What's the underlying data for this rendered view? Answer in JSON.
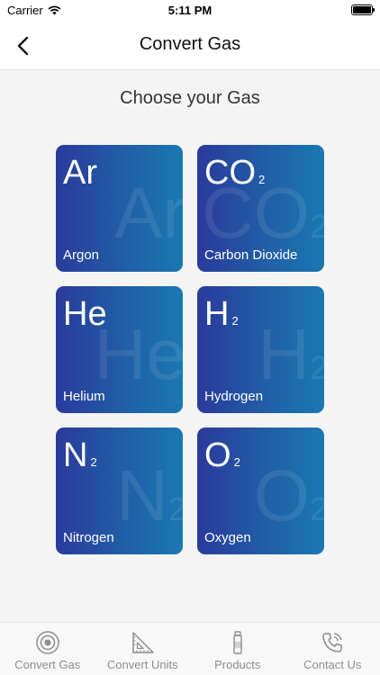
{
  "status_bar": {
    "carrier": "Carrier",
    "time": "5:11 PM"
  },
  "nav": {
    "title": "Convert Gas",
    "back_icon": "chevron-left-icon"
  },
  "subtitle": "Choose your Gas",
  "gases": [
    {
      "symbol": "Ar",
      "subscript": "",
      "name": "Argon"
    },
    {
      "symbol": "CO",
      "subscript": "2",
      "name": "Carbon Dioxide"
    },
    {
      "symbol": "He",
      "subscript": "",
      "name": "Helium"
    },
    {
      "symbol": "H",
      "subscript": "2",
      "name": "Hydrogen"
    },
    {
      "symbol": "N",
      "subscript": "2",
      "name": "Nitrogen"
    },
    {
      "symbol": "O",
      "subscript": "2",
      "name": "Oxygen"
    }
  ],
  "tabs": [
    {
      "label": "Convert Gas",
      "icon": "gas-cylinder-icon",
      "active": true
    },
    {
      "label": "Convert Units",
      "icon": "set-square-icon",
      "active": false
    },
    {
      "label": "Products",
      "icon": "bottle-icon",
      "active": false
    },
    {
      "label": "Contact Us",
      "icon": "phone-icon",
      "active": false
    }
  ],
  "colors": {
    "tile_gradient_start": "#2a3a9c",
    "tile_gradient_end": "#1a78b2",
    "tab_inactive": "#8e8e8e"
  }
}
